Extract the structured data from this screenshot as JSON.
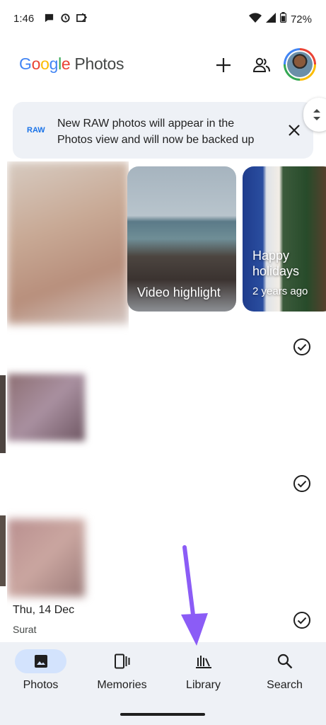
{
  "status_bar": {
    "time": "1:46",
    "battery": "72%",
    "notification_icons": [
      "chat-bubble-icon",
      "sync-icon",
      "image-card-icon"
    ],
    "system_icons": [
      "wifi-icon",
      "cell-signal-icon",
      "battery-icon"
    ]
  },
  "header": {
    "logo_letters": [
      "G",
      "o",
      "o",
      "g",
      "l",
      "e"
    ],
    "logo_product": "Photos",
    "add_icon": "plus-icon",
    "share_icon": "people-icon",
    "account_icon": "avatar"
  },
  "banner": {
    "badge": "RAW",
    "message": "New RAW photos will appear in the Photos view and will now be backed up",
    "close_icon": "close-icon"
  },
  "memories": [
    {
      "title": "Video highlight"
    },
    {
      "title": "Happy holidays",
      "subtitle": "2 years ago"
    }
  ],
  "date_group": {
    "date": "Thu, 14 Dec",
    "place": "Surat"
  },
  "bottom_nav": [
    {
      "label": "Photos",
      "icon": "photo-icon",
      "active": true
    },
    {
      "label": "Memories",
      "icon": "memories-icon",
      "active": false
    },
    {
      "label": "Library",
      "icon": "library-icon",
      "active": false
    },
    {
      "label": "Search",
      "icon": "search-icon",
      "active": false
    }
  ],
  "colors": {
    "accent": "#1a73e8",
    "nav_active_pill": "#d3e3fd",
    "surface": "#eef1f6",
    "annotation_arrow": "#8b5cf6"
  }
}
